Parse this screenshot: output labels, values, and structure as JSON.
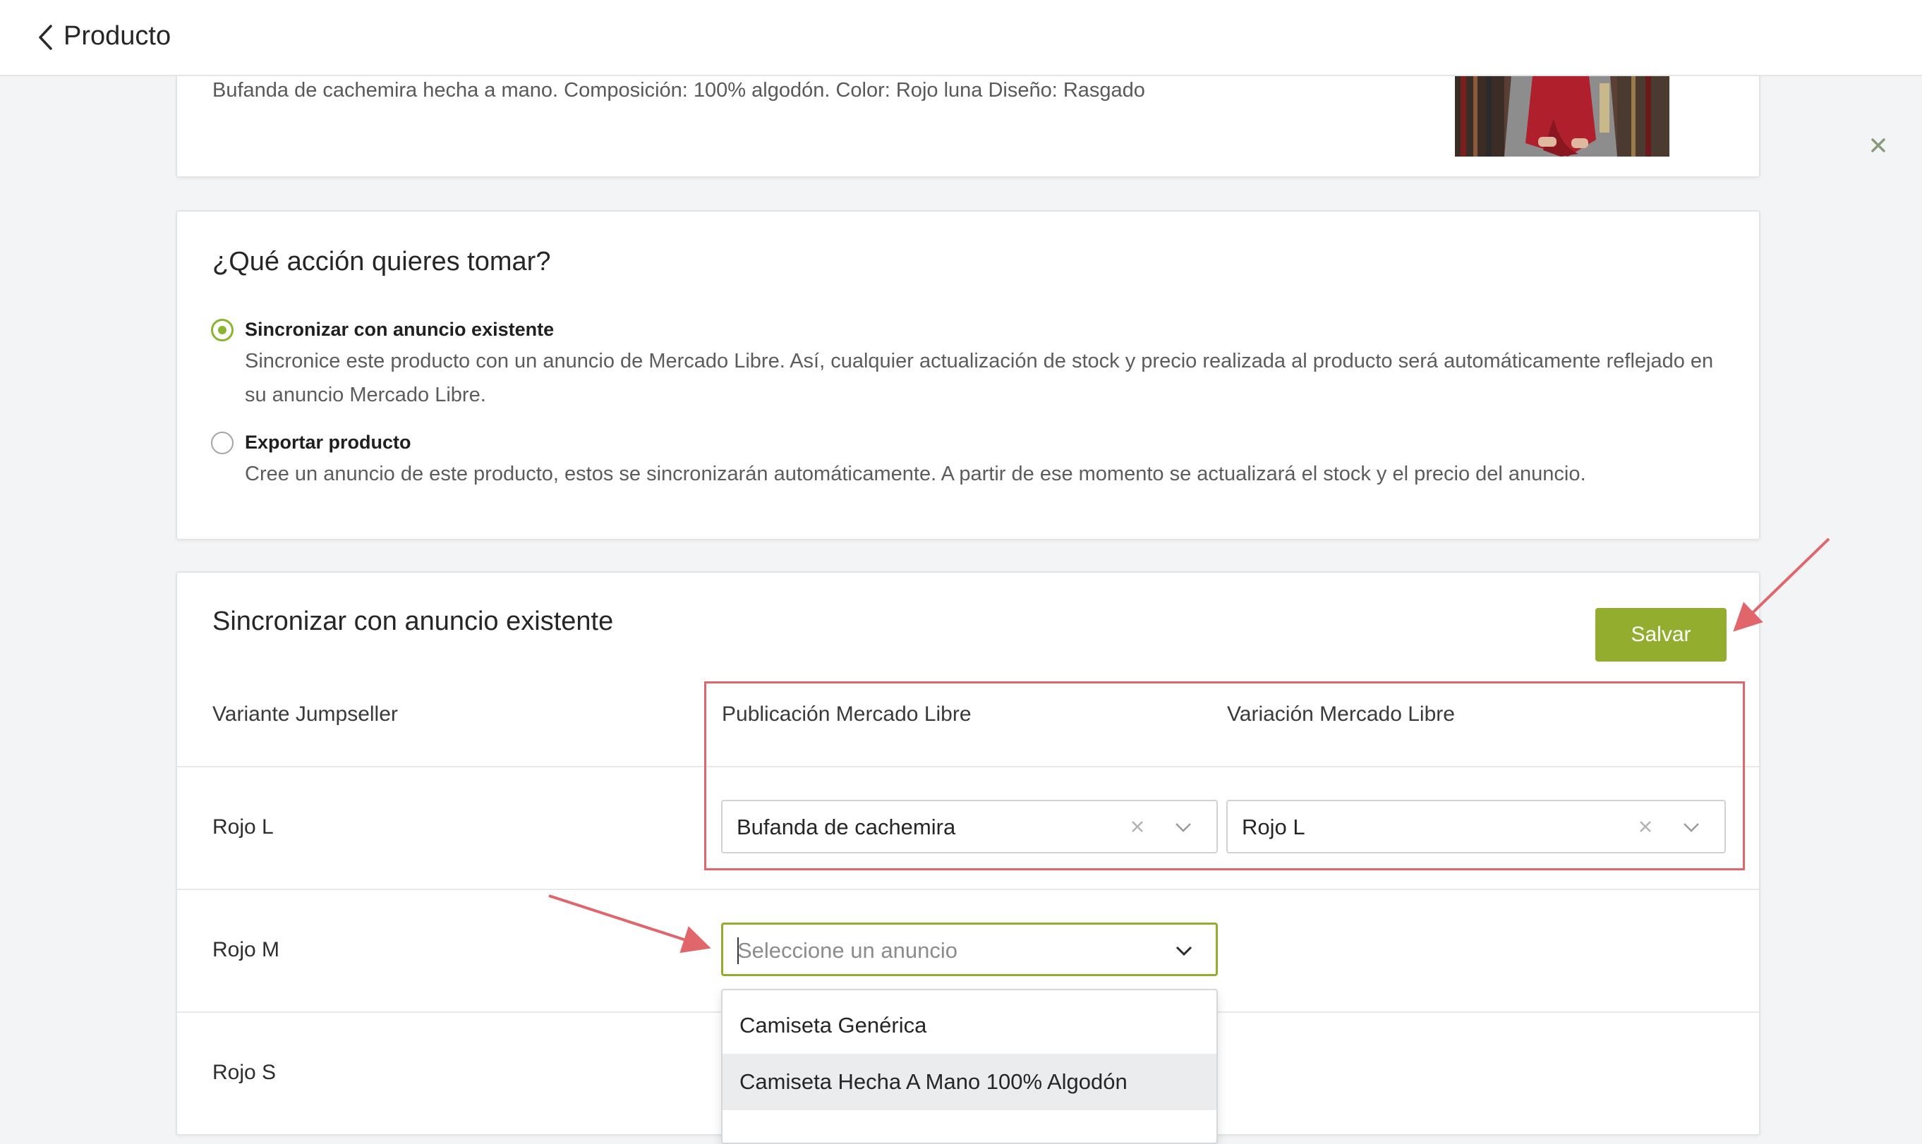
{
  "header": {
    "back_icon": "chevron-left-icon",
    "title": "Producto"
  },
  "close_icon": "close-icon",
  "product": {
    "description": "Bufanda de cachemira hecha a mano. Composición: 100% algodón. Color: Rojo luna Diseño: Rasgado"
  },
  "action": {
    "heading": "¿Qué acción quieres tomar?",
    "options": [
      {
        "label": "Sincronizar con anuncio existente",
        "description": "Sincronice este producto con un anuncio de Mercado Libre. Así, cualquier actualización de stock y precio realizada al producto será automáticamente reflejado en su anuncio Mercado Libre.",
        "selected": true
      },
      {
        "label": "Exportar producto",
        "description": "Cree un anuncio de este producto, estos se sincronizarán automáticamente. A partir de ese momento se actualizará el stock y el precio del anuncio.",
        "selected": false
      }
    ]
  },
  "sync": {
    "heading": "Sincronizar con anuncio existente",
    "save_label": "Salvar",
    "columns": [
      "Variante Jumpseller",
      "Publicación Mercado Libre",
      "Variación Mercado Libre"
    ],
    "rows": [
      {
        "variant": "Rojo L",
        "publication": "Bufanda de cachemira",
        "variation": "Rojo L"
      },
      {
        "variant": "Rojo M",
        "publication_placeholder": "Seleccione un anuncio"
      },
      {
        "variant": "Rojo S"
      }
    ],
    "dropdown_options": [
      "Camiseta Genérica",
      "Camiseta Hecha A Mano 100% Algodón"
    ]
  },
  "colors": {
    "accent": "#93ad2e",
    "radio_accent": "#8bb52e",
    "annotation": "#e0666b"
  }
}
